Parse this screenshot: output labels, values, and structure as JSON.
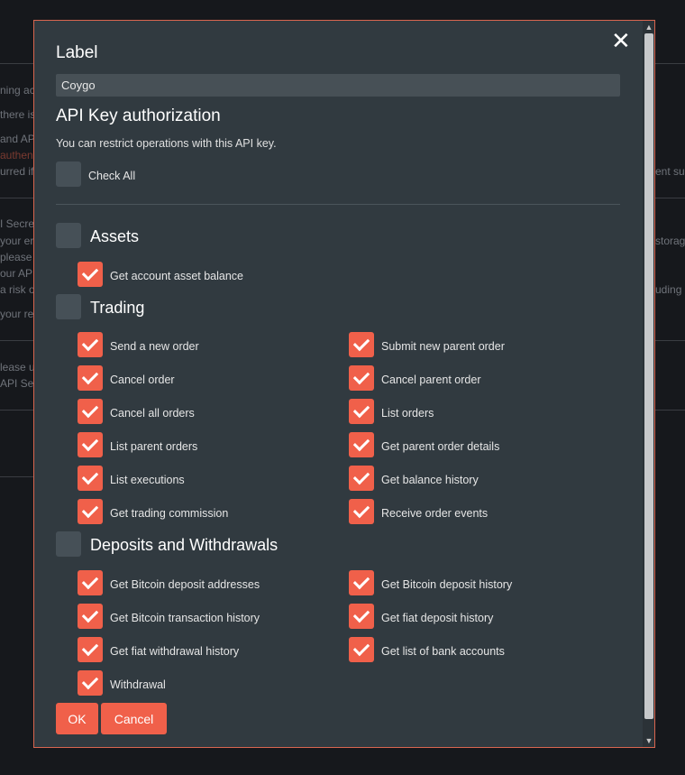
{
  "background": {
    "fragments": [
      "ning ac",
      "there is",
      "and AP",
      "authent",
      "urred if",
      "ent su",
      "I Secret",
      "your er",
      "please",
      "our API",
      "a risk o",
      "your ret",
      "storag",
      "uding b",
      "lease u",
      "API Sec"
    ]
  },
  "modal": {
    "close_glyph": "✕",
    "label_title": "Label",
    "label_value": "Coygo",
    "auth_title": "API Key authorization",
    "auth_desc": "You can restrict operations with this API key.",
    "check_all_label": "Check All",
    "check_all_checked": false,
    "groups": [
      {
        "title": "Assets",
        "checked": false,
        "options": [
          {
            "label": "Get account asset balance",
            "checked": true
          }
        ]
      },
      {
        "title": "Trading",
        "checked": false,
        "options": [
          {
            "label": "Send a new order",
            "checked": true
          },
          {
            "label": "Submit new parent order",
            "checked": true
          },
          {
            "label": "Cancel order",
            "checked": true
          },
          {
            "label": "Cancel parent order",
            "checked": true
          },
          {
            "label": "Cancel all orders",
            "checked": true
          },
          {
            "label": "List orders",
            "checked": true
          },
          {
            "label": "List parent orders",
            "checked": true
          },
          {
            "label": "Get parent order details",
            "checked": true
          },
          {
            "label": "List executions",
            "checked": true
          },
          {
            "label": "Get balance history",
            "checked": true
          },
          {
            "label": "Get trading commission",
            "checked": true
          },
          {
            "label": "Receive order events",
            "checked": true
          }
        ]
      },
      {
        "title": "Deposits and Withdrawals",
        "checked": false,
        "options": [
          {
            "label": "Get Bitcoin deposit addresses",
            "checked": true
          },
          {
            "label": "Get Bitcoin deposit history",
            "checked": true
          },
          {
            "label": "Get Bitcoin transaction history",
            "checked": true
          },
          {
            "label": "Get fiat deposit history",
            "checked": true
          },
          {
            "label": "Get fiat withdrawal history",
            "checked": true
          },
          {
            "label": "Get list of bank accounts",
            "checked": true
          },
          {
            "label": "Withdrawal",
            "checked": true
          }
        ]
      }
    ],
    "ok_label": "OK",
    "cancel_label": "Cancel",
    "scroll_up_glyph": "▲",
    "scroll_down_glyph": "▼"
  },
  "colors": {
    "accent": "#f0604a",
    "modal_bg": "#313a40",
    "page_bg": "#16181c"
  }
}
